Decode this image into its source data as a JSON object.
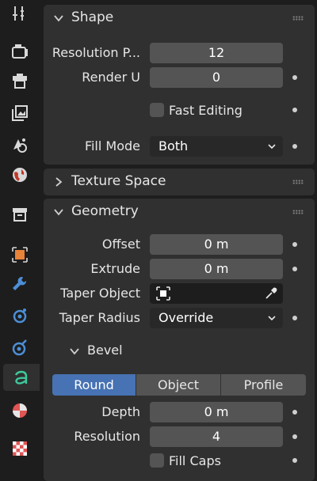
{
  "tabs": [
    {
      "name": "tool-icon"
    },
    {
      "name": "render-icon"
    },
    {
      "name": "output-icon"
    },
    {
      "name": "view-layer-icon"
    },
    {
      "name": "scene-icon"
    },
    {
      "name": "world-icon"
    },
    {
      "name": "collection-icon"
    },
    {
      "name": "object-icon"
    },
    {
      "name": "modifier-icon"
    },
    {
      "name": "particles-icon"
    },
    {
      "name": "physics-icon"
    },
    {
      "name": "curve-data-icon",
      "active": true
    },
    {
      "name": "material-icon"
    },
    {
      "name": "texture-icon"
    }
  ],
  "shape": {
    "title": "Shape",
    "resolution_label": "Resolution P...",
    "resolution_value": "12",
    "render_label": "Render U",
    "render_value": "0",
    "fast_editing_label": "Fast Editing",
    "fill_mode_label": "Fill Mode",
    "fill_mode_value": "Both"
  },
  "texture_space": {
    "title": "Texture Space"
  },
  "geometry": {
    "title": "Geometry",
    "offset_label": "Offset",
    "offset_value": "0 m",
    "extrude_label": "Extrude",
    "extrude_value": "0 m",
    "taper_object_label": "Taper Object",
    "taper_radius_label": "Taper Radius",
    "taper_radius_value": "Override"
  },
  "bevel": {
    "title": "Bevel",
    "modes": [
      "Round",
      "Object",
      "Profile"
    ],
    "active_mode": "Round",
    "depth_label": "Depth",
    "depth_value": "0 m",
    "resolution_label": "Resolution",
    "resolution_value": "4",
    "fill_caps_label": "Fill Caps"
  },
  "colors": {
    "accent": "#4772b3",
    "panel": "#303030",
    "field": "#545454",
    "background": "#1d1d1d"
  }
}
